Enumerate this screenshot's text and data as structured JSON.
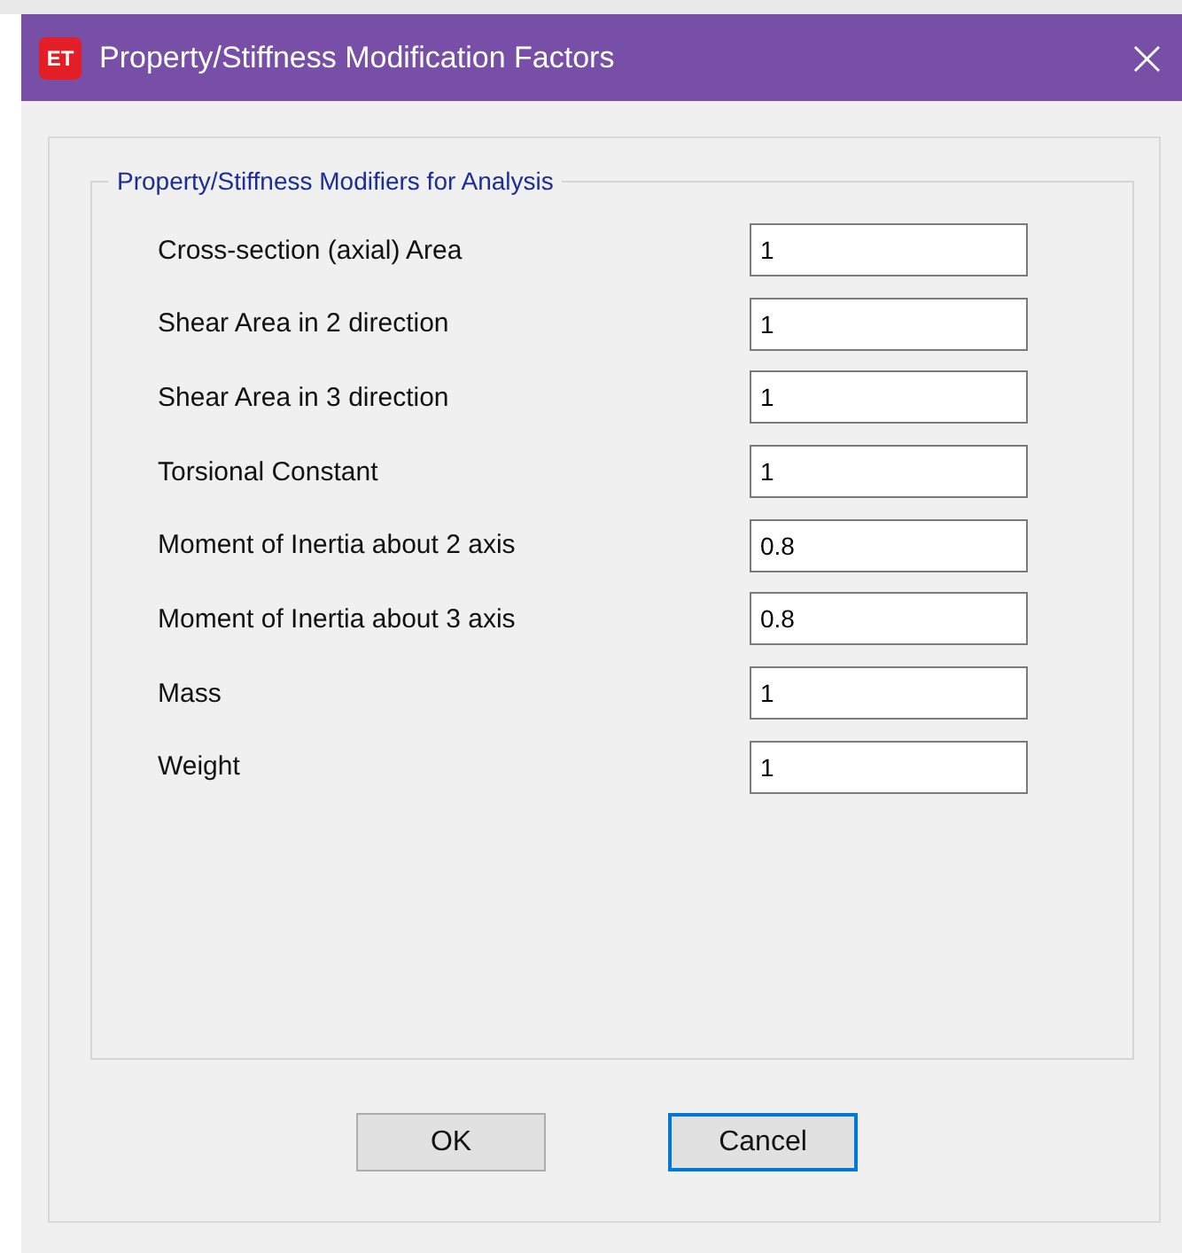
{
  "window": {
    "title": "Property/Stiffness Modification Factors",
    "app_badge": "ET",
    "close_glyph": "×"
  },
  "group": {
    "title": "Property/Stiffness Modifiers for Analysis",
    "fields": [
      {
        "label": "Cross-section (axial) Area",
        "value": "1"
      },
      {
        "label": "Shear Area in 2 direction",
        "value": "1"
      },
      {
        "label": "Shear Area in 3 direction",
        "value": "1"
      },
      {
        "label": "Torsional Constant",
        "value": "1"
      },
      {
        "label": "Moment of Inertia about 2 axis",
        "value": "0.8"
      },
      {
        "label": "Moment of Inertia about 3 axis",
        "value": "0.8"
      },
      {
        "label": "Mass",
        "value": "1"
      },
      {
        "label": "Weight",
        "value": "1"
      }
    ]
  },
  "buttons": [
    {
      "label": "OK",
      "focused": false
    },
    {
      "label": "Cancel",
      "focused": true
    }
  ]
}
